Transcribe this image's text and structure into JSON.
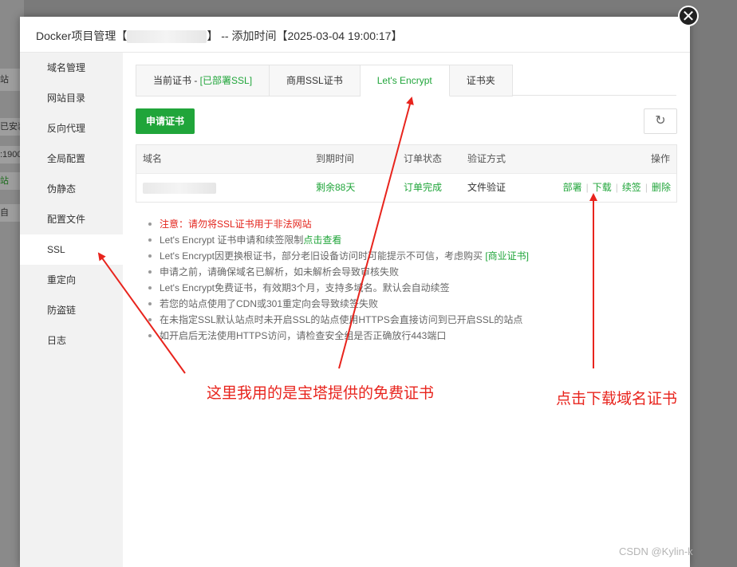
{
  "background": {
    "fragments": [
      "站",
      "已安装",
      ":1900",
      "站",
      "自"
    ]
  },
  "modal": {
    "title_prefix": "Docker项目管理【",
    "title_suffix": "】 -- 添加时间【2025-03-04 19:00:17】",
    "close_icon": "close-icon"
  },
  "sidebar": {
    "items": [
      {
        "label": "域名管理"
      },
      {
        "label": "网站目录"
      },
      {
        "label": "反向代理"
      },
      {
        "label": "全局配置"
      },
      {
        "label": "伪静态"
      },
      {
        "label": "配置文件"
      },
      {
        "label": "SSL"
      },
      {
        "label": "重定向"
      },
      {
        "label": "防盗链"
      },
      {
        "label": "日志"
      }
    ],
    "active": "SSL"
  },
  "tabs": {
    "current_cert_label": "当前证书 - ",
    "current_cert_status": "[已部署SSL]",
    "commercial": "商用SSL证书",
    "letsencrypt": "Let's Encrypt",
    "folder": "证书夹",
    "active": "Let's Encrypt"
  },
  "toolbar": {
    "apply_label": "申请证书",
    "refresh_icon": "refresh-icon"
  },
  "table": {
    "headers": {
      "domain": "域名",
      "expire": "到期时间",
      "order_status": "订单状态",
      "verify": "验证方式",
      "actions": "操作"
    },
    "rows": [
      {
        "domain": "",
        "expire": "剩余88天",
        "order_status": "订单完成",
        "verify": "文件验证",
        "deploy": "部署",
        "download": "下载",
        "renew": "续签",
        "delete": "删除"
      }
    ]
  },
  "notes": {
    "n1": "注意：请勿将SSL证书用于非法网站",
    "n2_prefix": "Let's Encrypt 证书申请和续签限制",
    "n2_link": "点击查看",
    "n3_prefix": "Let's Encrypt因更换根证书，部分老旧设备访问时可能提示不可信，考虑购买 ",
    "n3_link": "[商业证书]",
    "n4": "申请之前，请确保域名已解析，如未解析会导致审核失败",
    "n5": "Let's Encrypt免费证书，有效期3个月，支持多域名。默认会自动续签",
    "n6": "若您的站点使用了CDN或301重定向会导致续签失败",
    "n7": "在未指定SSL默认站点时未开启SSL的站点使用HTTPS会直接访问到已开启SSL的站点",
    "n8": "如开启后无法使用HTTPS访问，请检查安全组是否正确放行443端口"
  },
  "annotations": {
    "free_cert": "这里我用的是宝塔提供的免费证书",
    "download_hint": "点击下载域名证书",
    "color": "#e8241d"
  },
  "watermark": "CSDN @Kylin-k",
  "colors": {
    "accent": "#20a53a",
    "warning": "#e3231b"
  }
}
